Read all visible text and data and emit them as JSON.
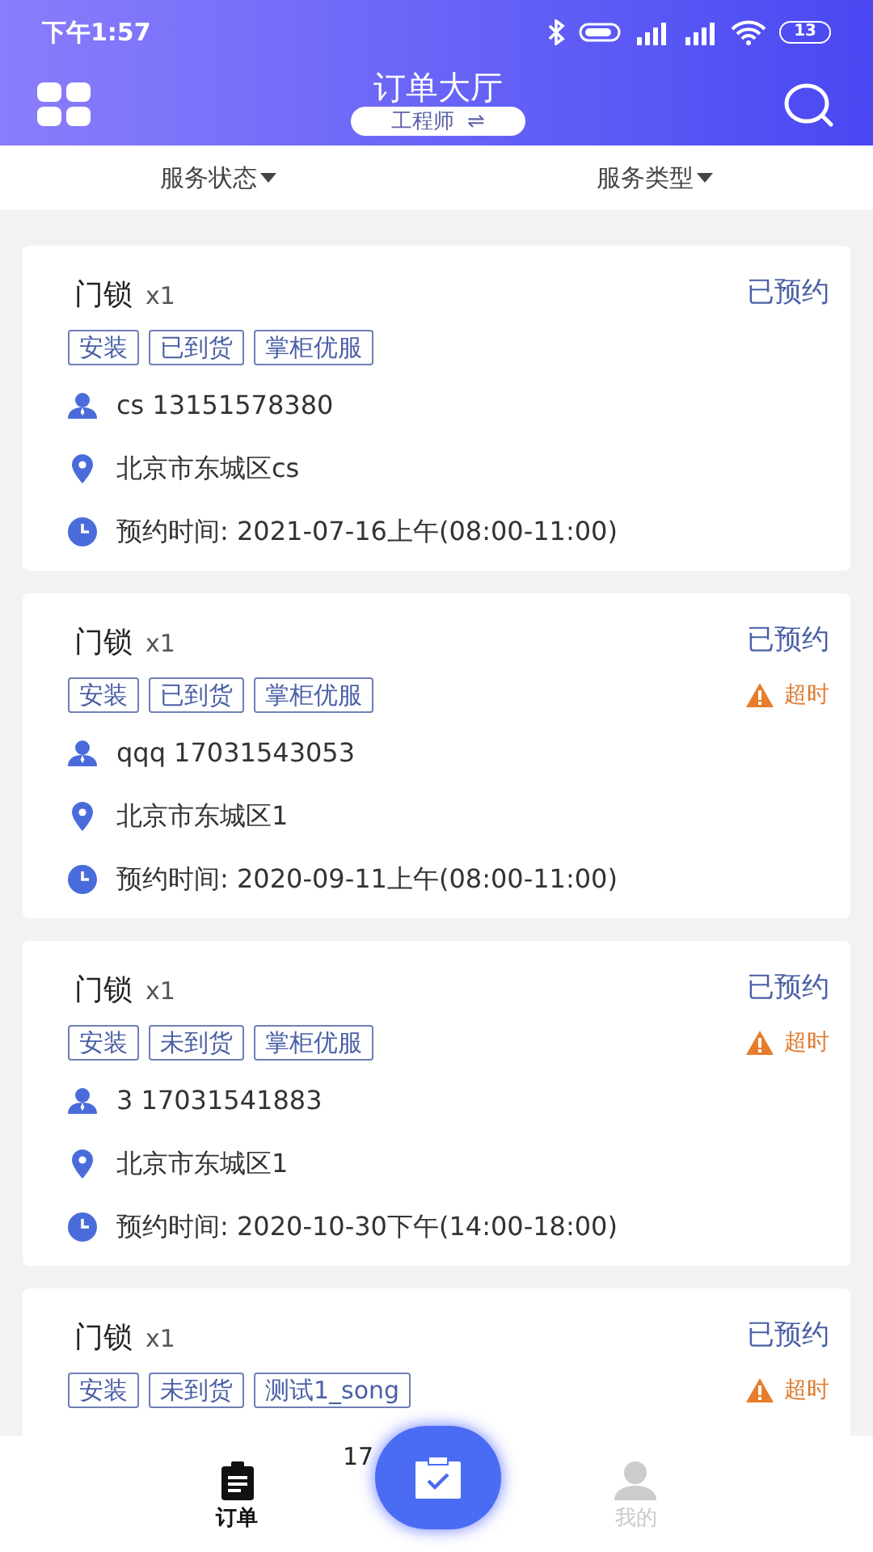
{
  "status_bar": {
    "time": "下午1:57",
    "battery": "13"
  },
  "header": {
    "title": "订单大厅",
    "role": "工程师",
    "role_switch": "⇌"
  },
  "filters": [
    {
      "label": "服务状态"
    },
    {
      "label": "服务类型"
    }
  ],
  "orders": [
    {
      "product": "门锁",
      "quantity": "x1",
      "status": "已预约",
      "overdue": false,
      "tags": [
        "安装",
        "已到货",
        "掌柜优服"
      ],
      "contact": "cs 13151578380",
      "address": "北京市东城区cs",
      "appointment": "预约时间: 2021-07-16上午(08:00-11:00)"
    },
    {
      "product": "门锁",
      "quantity": "x1",
      "status": "已预约",
      "overdue": true,
      "overdue_label": "超时",
      "tags": [
        "安装",
        "已到货",
        "掌柜优服"
      ],
      "contact": "qqq 17031543053",
      "address": "北京市东城区1",
      "appointment": "预约时间: 2020-09-11上午(08:00-11:00)"
    },
    {
      "product": "门锁",
      "quantity": "x1",
      "status": "已预约",
      "overdue": true,
      "overdue_label": "超时",
      "tags": [
        "安装",
        "未到货",
        "掌柜优服"
      ],
      "contact": "3 17031541883",
      "address": "北京市东城区1",
      "appointment": "预约时间: 2020-10-30下午(14:00-18:00)"
    },
    {
      "product": "门锁",
      "quantity": "x1",
      "status": "已预约",
      "overdue": true,
      "overdue_label": "超时",
      "tags": [
        "安装",
        "未到货",
        "测试1_song"
      ]
    }
  ],
  "bottom_nav": {
    "items": [
      {
        "label": "订单",
        "selected": true
      },
      {
        "label": "我的",
        "selected": false
      }
    ],
    "badge": "17"
  }
}
